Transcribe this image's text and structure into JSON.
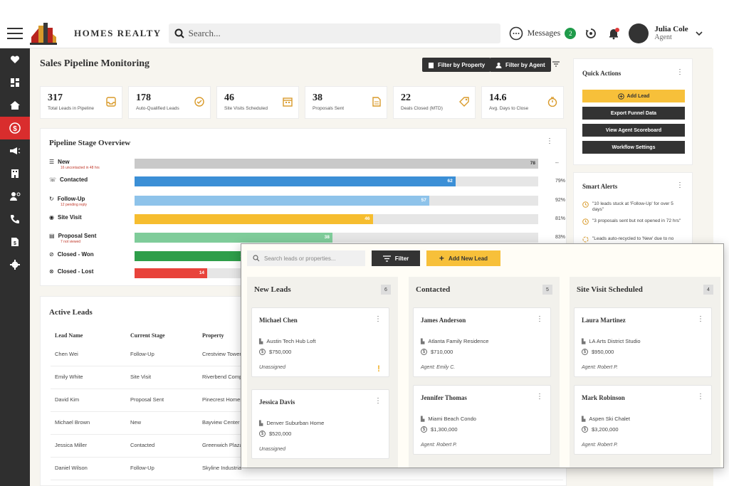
{
  "header": {
    "brand": "HOMES REALTY",
    "search_placeholder": "Search...",
    "messages_label": "Messages",
    "messages_count": "2",
    "user_name": "Julia Cole",
    "user_role": "Agent"
  },
  "sidebar": {
    "items": [
      "heart-icon",
      "dashboard-icon",
      "properties-icon",
      "dollar-icon",
      "megaphone-icon",
      "building-icon",
      "agents-icon",
      "phone-icon",
      "document-icon",
      "settings-icon"
    ],
    "active_index": 3
  },
  "main": {
    "title": "Sales Pipeline Monitoring",
    "filter_property": "Filter by Property",
    "filter_agent": "Filter by Agent"
  },
  "kpis": [
    {
      "value": "317",
      "label": "Total Leads in Pipeline",
      "icon": "inbox-icon"
    },
    {
      "value": "178",
      "label": "Auto-Qualified Leads",
      "icon": "check-circle-icon"
    },
    {
      "value": "46",
      "label": "Site Visits Scheduled",
      "icon": "calendar-icon"
    },
    {
      "value": "38",
      "label": "Proposals Sent",
      "icon": "document-icon"
    },
    {
      "value": "22",
      "label": "Deals Closed (MTD)",
      "icon": "tag-icon"
    },
    {
      "value": "14.6",
      "label": "Avg. Days to Close",
      "icon": "stopwatch-icon"
    }
  ],
  "pipeline": {
    "title": "Pipeline Stage Overview",
    "stages": [
      {
        "label": "New",
        "sub": "16 uncontacted in 48 hrs",
        "value": 78,
        "fraction": 1.0,
        "pct": "--",
        "color": "#c9c9c9"
      },
      {
        "label": "Contacted",
        "sub": "",
        "value": 62,
        "fraction": 0.795,
        "pct": "79%",
        "color": "#3b8fd6"
      },
      {
        "label": "Follow-Up",
        "sub": "12 pending reply",
        "value": 57,
        "fraction": 0.73,
        "pct": "92%",
        "color": "#8ec3ea"
      },
      {
        "label": "Site Visit",
        "sub": "",
        "value": 46,
        "fraction": 0.59,
        "pct": "81%",
        "color": "#f6bd2f"
      },
      {
        "label": "Proposal Sent",
        "sub": "7 not viewed",
        "value": 38,
        "fraction": 0.49,
        "pct": "83%",
        "color": "#7fcc9a"
      },
      {
        "label": "Closed - Won",
        "sub": "",
        "value": 22,
        "fraction": 0.282,
        "pct": "",
        "color": "#2e9e4a"
      },
      {
        "label": "Closed - Lost",
        "sub": "",
        "value": 14,
        "fraction": 0.18,
        "pct": "",
        "color": "#e8433b"
      }
    ]
  },
  "active_leads": {
    "title": "Active Leads",
    "columns": [
      "Lead Name",
      "Current Stage",
      "Property"
    ],
    "rows": [
      [
        "Chen Wei",
        "Follow-Up",
        "Crestview Tower"
      ],
      [
        "Emily White",
        "Site Visit",
        "Riverbend Comp"
      ],
      [
        "David Kim",
        "Proposal Sent",
        "Pinecrest Homes"
      ],
      [
        "Michael Brown",
        "New",
        "Bayview Center"
      ],
      [
        "Jessica Miller",
        "Contacted",
        "Greenwich Plaza"
      ],
      [
        "Daniel Wilson",
        "Follow-Up",
        "Skyline Industria"
      ]
    ]
  },
  "quick_actions": {
    "title": "Quick Actions",
    "buttons": [
      "Add Lead",
      "Export Funnel Data",
      "View Agent Scoreboard",
      "Workflow Settings"
    ]
  },
  "smart_alerts": {
    "title": "Smart Alerts",
    "items": [
      "\"10 leads stuck at 'Follow-Up' for over 5 days\"",
      "\"3 proposals sent but not opened in 72 hrs\"",
      "\"Leads auto-recycled to 'New' due to no"
    ]
  },
  "kanban": {
    "search_placeholder": "Search leads or properties...",
    "filter_label": "Filter",
    "add_label": "Add New Lead",
    "columns": [
      {
        "title": "New Leads",
        "count": "6",
        "cards": [
          {
            "name": "Michael Chen",
            "property": "Austin Tech Hub Loft",
            "price": "$750,000",
            "agent": "Unassigned",
            "warn": true
          },
          {
            "name": "Jessica Davis",
            "property": "Denver Suburban Home",
            "price": "$520,000",
            "agent": "Unassigned",
            "warn": false
          }
        ]
      },
      {
        "title": "Contacted",
        "count": "5",
        "cards": [
          {
            "name": "James Anderson",
            "property": "Atlanta Family Residence",
            "price": "$710,000",
            "agent": "Agent: Emily C.",
            "warn": false
          },
          {
            "name": "Jennifer Thomas",
            "property": "Miami Beach Condo",
            "price": "$1,300,000",
            "agent": "Agent: Robert P.",
            "warn": false
          }
        ]
      },
      {
        "title": "Site Visit Scheduled",
        "count": "4",
        "cards": [
          {
            "name": "Laura Martinez",
            "property": "LA Arts District Studio",
            "price": "$950,000",
            "agent": "Agent: Robert P.",
            "warn": false
          },
          {
            "name": "Mark Robinson",
            "property": "Aspen Ski Chalet",
            "price": "$3,200,000",
            "agent": "Agent: Robert P.",
            "warn": false
          }
        ]
      }
    ]
  }
}
